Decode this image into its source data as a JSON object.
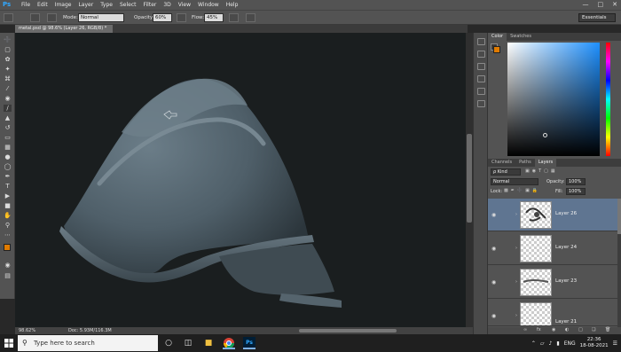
{
  "menubar": {
    "items": [
      "File",
      "Edit",
      "Image",
      "Layer",
      "Type",
      "Select",
      "Filter",
      "3D",
      "View",
      "Window",
      "Help"
    ]
  },
  "options": {
    "mode_label": "Mode:",
    "mode_value": "Normal",
    "opacity_label": "Opacity:",
    "opacity_value": "60%",
    "flow_label": "Flow:",
    "flow_value": "45%",
    "workspace": "Essentials"
  },
  "document": {
    "tab_title": "metal.psd @ 98.6% (Layer 26, RGB/8) *",
    "zoom": "98.62%",
    "doc_info": "Doc: 5.93M/116.3M"
  },
  "color_panel": {
    "tabs": [
      "Color",
      "Swatches"
    ],
    "foreground": "#e07b00",
    "background": "#3a3a3a"
  },
  "layers_panel": {
    "tabs": [
      "Channels",
      "Paths",
      "Layers"
    ],
    "kind_label": "ρ Kind",
    "blend_mode": "Normal",
    "opacity_label": "Opacity:",
    "opacity_value": "100%",
    "lock_label": "Lock:",
    "fill_label": "Fill:",
    "fill_value": "100%",
    "layers": [
      {
        "name": "Layer 26",
        "selected": true
      },
      {
        "name": "Layer 24",
        "selected": false
      },
      {
        "name": "Layer 23",
        "selected": false
      },
      {
        "name": "Layer 21",
        "selected": false
      }
    ]
  },
  "taskbar": {
    "search_placeholder": "Type here to search",
    "language": "ENG",
    "time": "22:36",
    "date": "18-08-2021"
  }
}
